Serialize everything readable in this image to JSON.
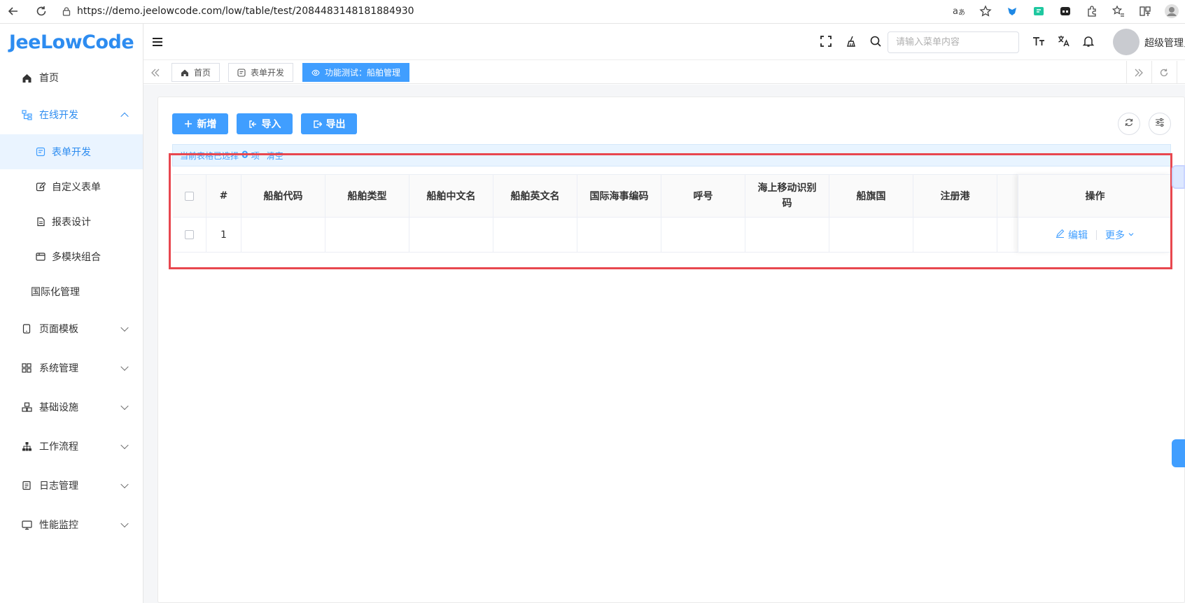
{
  "browser": {
    "url": "https://demo.jeelowcode.com/low/table/test/2084483148181884930"
  },
  "app": {
    "logo": "JeeLowCode",
    "search_placeholder": "请输入菜单内容",
    "username": "超级管理员",
    "accent_color": "#409eff"
  },
  "sidebar": {
    "home": "首页",
    "online_dev": "在线开发",
    "sub_items": [
      "表单开发",
      "自定义表单",
      "报表设计",
      "多模块组合"
    ],
    "i18n": "国际化管理",
    "groups": [
      "页面模板",
      "系统管理",
      "基础设施",
      "工作流程",
      "日志管理",
      "性能监控"
    ]
  },
  "tabs": [
    "首页",
    "表单开发",
    "功能测试：船舶管理"
  ],
  "toolbar": {
    "add_label": "新增",
    "import_label": "导入",
    "export_label": "导出"
  },
  "selection": {
    "prefix": "当前表格已选择",
    "count": "0",
    "suffix": "项",
    "clear_label": "清空"
  },
  "table": {
    "columns": [
      "#",
      "船舶代码",
      "船舶类型",
      "船舶中文名",
      "船舶英文名",
      "国际海事编码",
      "呼号",
      "海上移动识别码",
      "船旗国",
      "注册港"
    ],
    "op_header": "操作",
    "rows": [
      {
        "index": "1",
        "values": [
          "",
          "",
          "",
          "",
          "",
          "",
          "",
          "",
          ""
        ]
      }
    ],
    "edit_label": "编辑",
    "more_label": "更多"
  }
}
